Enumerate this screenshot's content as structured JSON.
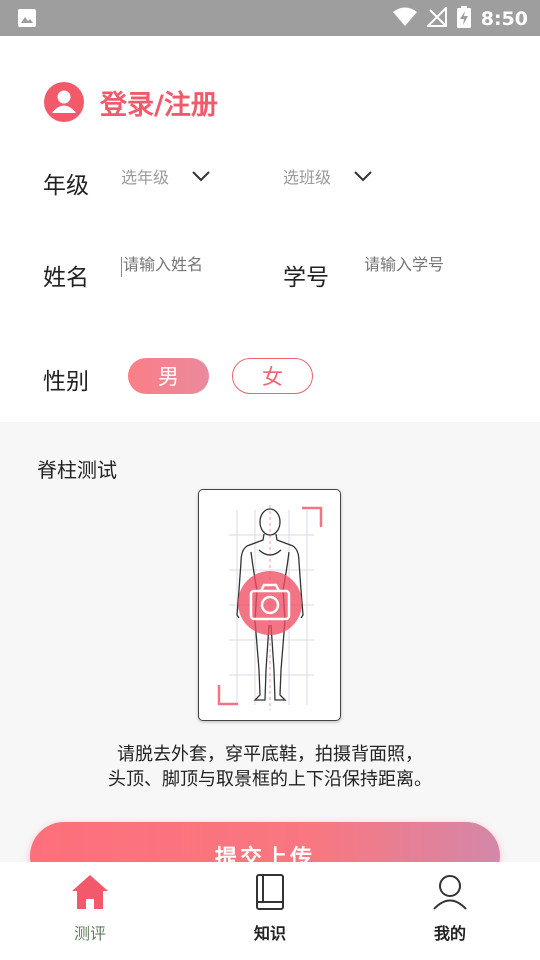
{
  "status_bar": {
    "time": "8:50",
    "icons": [
      "image-icon",
      "wifi-icon",
      "no-signal-icon",
      "battery-charging-icon"
    ]
  },
  "header": {
    "login_label": "登录/注册",
    "accent": "#f25a6b"
  },
  "form": {
    "grade_label": "年级",
    "grade_select": "选年级",
    "class_select": "选班级",
    "name_label": "姓名",
    "name_placeholder": "请输入姓名",
    "student_id_label": "学号",
    "student_id_placeholder": "请输入学号",
    "gender_label": "性别",
    "gender_options": [
      "男",
      "女"
    ],
    "gender_selected": "男"
  },
  "spine_test": {
    "title": "脊柱测试",
    "instructions_line1": "请脱去外套，穿平底鞋，拍摄背面照，",
    "instructions_line2": "头顶、脚顶与取景框的上下沿保持距离。",
    "submit_label": "提交上传"
  },
  "bottom_nav": {
    "items": [
      {
        "label": "测评",
        "icon": "home-icon",
        "active": true
      },
      {
        "label": "知识",
        "icon": "book-icon",
        "active": false
      },
      {
        "label": "我的",
        "icon": "user-icon",
        "active": false
      }
    ],
    "active_color": "#f25a6b"
  }
}
